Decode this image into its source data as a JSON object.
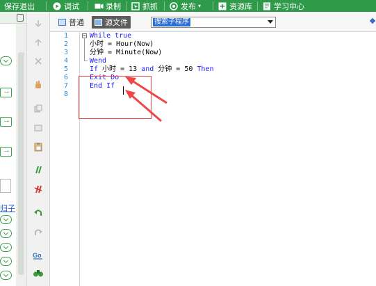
{
  "toolbar": {
    "items": [
      {
        "label": "保存退出",
        "icon": "save-exit-icon"
      },
      {
        "label": "调试",
        "icon": "play-icon"
      },
      {
        "label": "录制",
        "icon": "record-icon"
      },
      {
        "label": "抓抓",
        "icon": "capture-icon"
      },
      {
        "label": "发布",
        "icon": "publish-icon"
      },
      {
        "label": "资源库",
        "icon": "resource-icon"
      },
      {
        "label": "学习中心",
        "icon": "learning-icon"
      }
    ]
  },
  "left_panel": {
    "link_text": "归子",
    "colors": {
      "button_green": "#3aa24a"
    }
  },
  "tabs": [
    {
      "label": "普通",
      "active": false
    },
    {
      "label": "源文件",
      "active": true
    }
  ],
  "sub_select": {
    "value": "搜索子程序"
  },
  "editor": {
    "line_numbers": [
      "1",
      "2",
      "3",
      "4",
      "5",
      "6",
      "7",
      "8"
    ],
    "lines": [
      [
        {
          "t": "While true",
          "k": true
        }
      ],
      [
        {
          "t": "小时 = Hour(Now)",
          "k": false
        }
      ],
      [
        {
          "t": "分钟 = Minute(Now)",
          "k": false
        }
      ],
      [
        {
          "t": "Wend",
          "k": true
        }
      ],
      [
        {
          "t": "If ",
          "k": true
        },
        {
          "t": "小时 = 13 ",
          "k": false
        },
        {
          "t": "and",
          "k": true
        },
        {
          "t": " 分钟 = 50 ",
          "k": false
        },
        {
          "t": "Then",
          "k": true
        }
      ],
      [
        {
          "t": "Exit Do",
          "k": true
        }
      ],
      [
        {
          "t": "End If",
          "k": true
        }
      ],
      []
    ]
  },
  "annotation_color": "#f04646",
  "accent_color": "#2f9a4a"
}
